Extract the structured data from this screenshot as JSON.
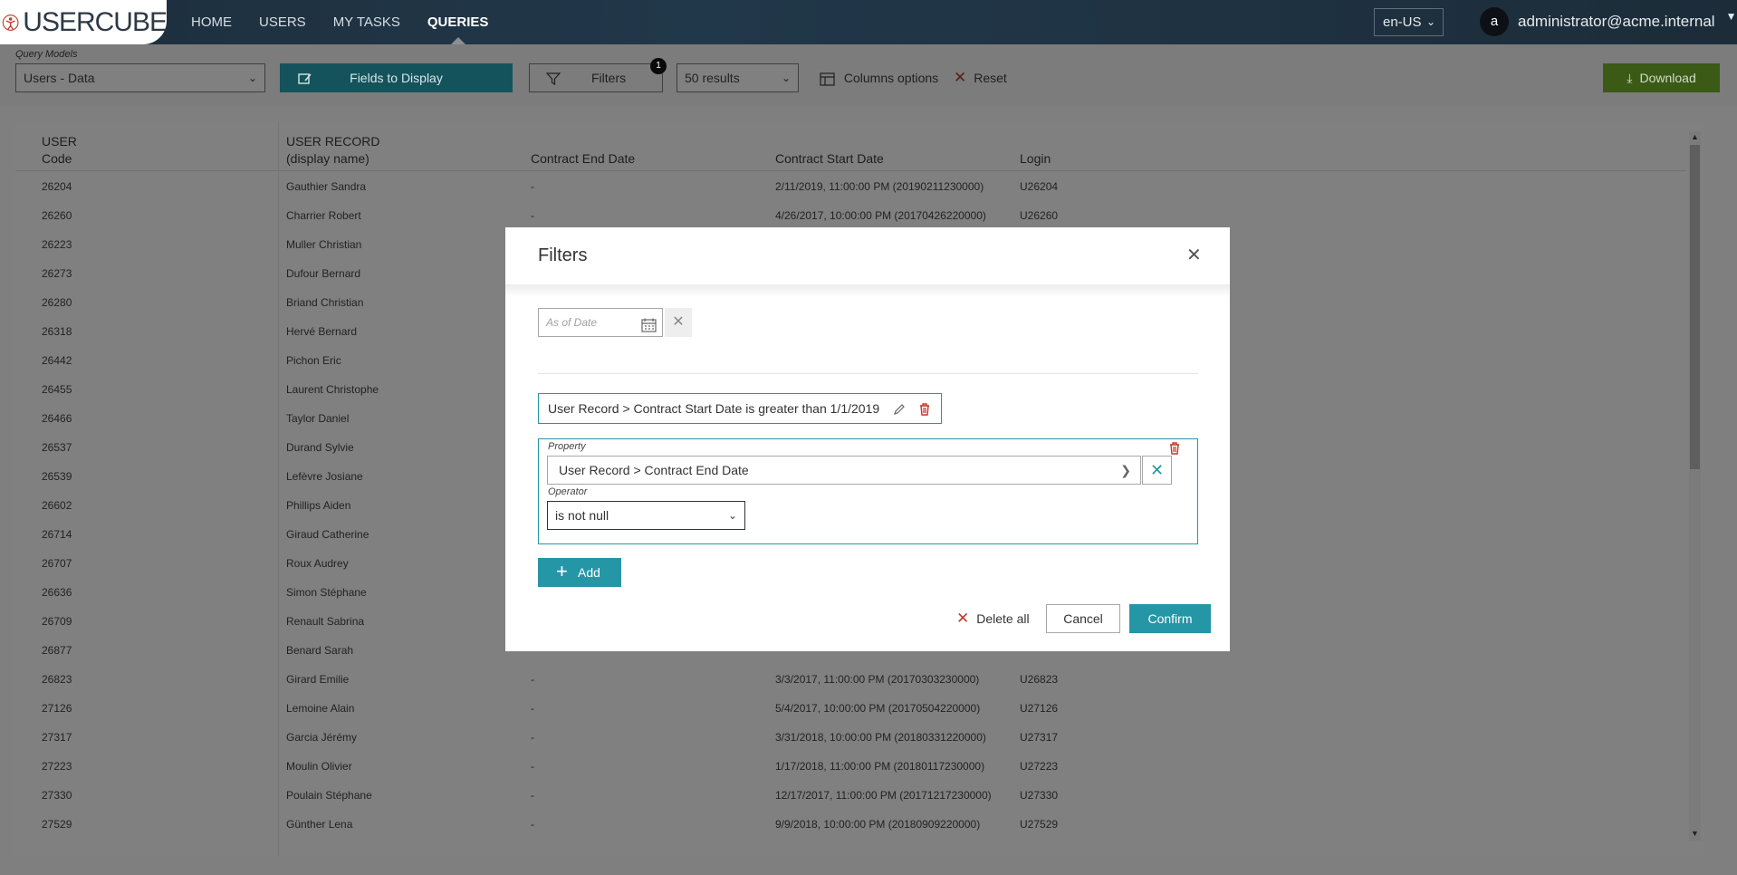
{
  "app": {
    "brand": "USERCUBE"
  },
  "nav": {
    "items": [
      "HOME",
      "USERS",
      "MY TASKS",
      "QUERIES"
    ],
    "active": "QUERIES"
  },
  "header": {
    "language": "en-US",
    "user_initial": "a",
    "user_email": "administrator@acme.internal"
  },
  "toolbar": {
    "query_models_label": "Query Models",
    "query_model_value": "Users - Data",
    "fields_button": "Fields to Display",
    "filters_button": "Filters",
    "filters_count": "1",
    "results_value": "50 results",
    "columns_options": "Columns options",
    "reset": "Reset",
    "download": "Download"
  },
  "table": {
    "headers": [
      {
        "line1": "USER",
        "line2": "Code"
      },
      {
        "line1": "USER RECORD",
        "line2": "(display name)"
      },
      {
        "line1": "",
        "line2": "Contract End Date"
      },
      {
        "line1": "",
        "line2": "Contract Start Date"
      },
      {
        "line1": "",
        "line2": "Login"
      }
    ],
    "rows": [
      [
        "26204",
        "Gauthier Sandra",
        "-",
        "2/11/2019, 11:00:00 PM (20190211230000)",
        "U26204"
      ],
      [
        "26260",
        "Charrier Robert",
        "-",
        "4/26/2017, 10:00:00 PM (20170426220000)",
        "U26260"
      ],
      [
        "26223",
        "Muller Christian",
        "",
        "",
        ""
      ],
      [
        "26273",
        "Dufour Bernard",
        "",
        "",
        ""
      ],
      [
        "26280",
        "Briand Christian",
        "",
        "",
        ""
      ],
      [
        "26318",
        "Hervé Bernard",
        "",
        "",
        ""
      ],
      [
        "26442",
        "Pichon Eric",
        "",
        "",
        ""
      ],
      [
        "26455",
        "Laurent Christophe",
        "",
        "",
        ""
      ],
      [
        "26466",
        "Taylor Daniel",
        "",
        "",
        ""
      ],
      [
        "26537",
        "Durand Sylvie",
        "",
        "",
        ""
      ],
      [
        "26539",
        "Lefèvre Josiane",
        "",
        "",
        ""
      ],
      [
        "26602",
        "Phillips Aiden",
        "",
        "",
        ""
      ],
      [
        "26714",
        "Giraud Catherine",
        "",
        "",
        ""
      ],
      [
        "26707",
        "Roux Audrey",
        "",
        "",
        ""
      ],
      [
        "26636",
        "Simon Stéphane",
        "",
        "",
        ""
      ],
      [
        "26709",
        "Renault Sabrina",
        "",
        "",
        ""
      ],
      [
        "26877",
        "Benard Sarah",
        "",
        "",
        ""
      ],
      [
        "26823",
        "Girard Emilie",
        "-",
        "3/3/2017, 11:00:00 PM (20170303230000)",
        "U26823"
      ],
      [
        "27126",
        "Lemoine Alain",
        "-",
        "5/4/2017, 10:00:00 PM (20170504220000)",
        "U27126"
      ],
      [
        "27317",
        "Garcia Jérémy",
        "-",
        "3/31/2018, 10:00:00 PM (20180331220000)",
        "U27317"
      ],
      [
        "27223",
        "Moulin Olivier",
        "-",
        "1/17/2018, 11:00:00 PM (20180117230000)",
        "U27223"
      ],
      [
        "27330",
        "Poulain Stéphane",
        "-",
        "12/17/2017, 11:00:00 PM (20171217230000)",
        "U27330"
      ],
      [
        "27529",
        "Günther Lena",
        "-",
        "9/9/2018, 10:00:00 PM (20180909220000)",
        "U27529"
      ]
    ]
  },
  "modal": {
    "title": "Filters",
    "as_of_date_placeholder": "As of Date",
    "existing_filter": "User Record > Contract Start Date is greater than 1/1/2019",
    "property_label": "Property",
    "property_value": "User Record > Contract End Date",
    "operator_label": "Operator",
    "operator_value": "is not null",
    "add_button": "Add",
    "delete_all": "Delete all",
    "cancel": "Cancel",
    "confirm": "Confirm"
  },
  "colors": {
    "accent": "#2596a6",
    "delete": "#c0392b",
    "download_green": "#3a5a15"
  }
}
